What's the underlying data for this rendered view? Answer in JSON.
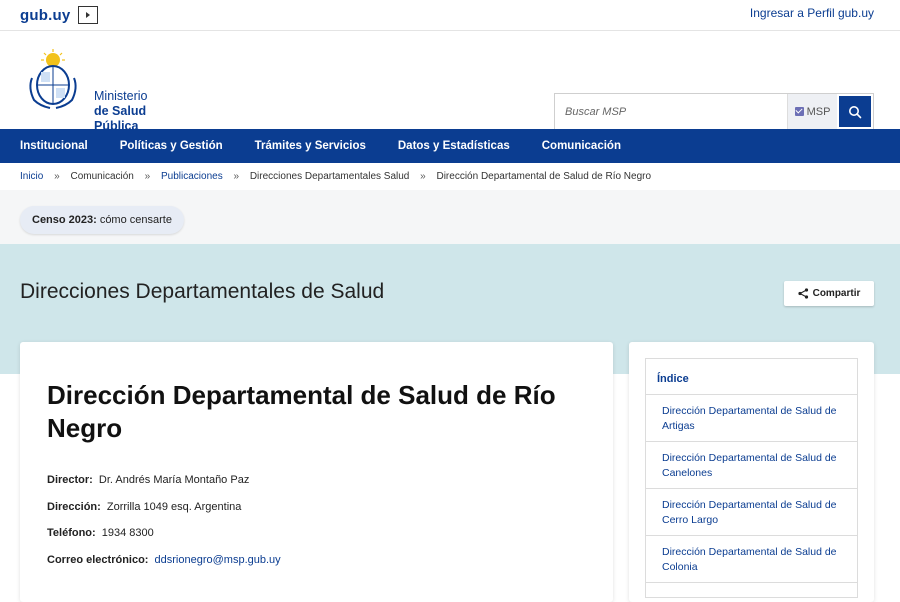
{
  "topbar": {
    "logo": "gub.uy",
    "login_link": "Ingresar a Perfil gub.uy"
  },
  "header": {
    "ministry_line1": "Ministerio",
    "ministry_line2": "de Salud",
    "ministry_line3": "Pública",
    "search_placeholder": "Buscar MSP",
    "search_filter_label": "MSP"
  },
  "nav": {
    "items": [
      "Institucional",
      "Políticas y Gestión",
      "Trámites y Servicios",
      "Datos y Estadísticas",
      "Comunicación"
    ]
  },
  "breadcrumb": {
    "items": [
      "Inicio",
      "Comunicación",
      "Publicaciones",
      "Direcciones Departamentales Salud",
      "Dirección Departamental de Salud de Río Negro"
    ],
    "separator": "»"
  },
  "censo": {
    "bold": "Censo 2023:",
    "text": "cómo censarte"
  },
  "hero": {
    "title": "Direcciones Departamentales de Salud",
    "share_label": "Compartir"
  },
  "main": {
    "title": "Dirección Departamental de Salud de Río Negro",
    "director_label": "Director:",
    "director_value": "Dr. Andrés María Montaño Paz",
    "address_label": "Dirección:",
    "address_value": "Zorrilla 1049 esq. Argentina",
    "phone_label": "Teléfono:",
    "phone_value": "1934 8300",
    "email_label": "Correo electrónico:",
    "email_value": "ddsrionegro@msp.gub.uy"
  },
  "sidebar": {
    "index_title": "Índice",
    "items": [
      "Dirección Departamental de Salud de Artigas",
      "Dirección Departamental de Salud de Canelones",
      "Dirección Departamental de Salud de Cerro Largo",
      "Dirección Departamental de Salud de Colonia"
    ]
  },
  "colors": {
    "brand": "#0b3d91",
    "hero_bg": "#cfe6ea"
  }
}
